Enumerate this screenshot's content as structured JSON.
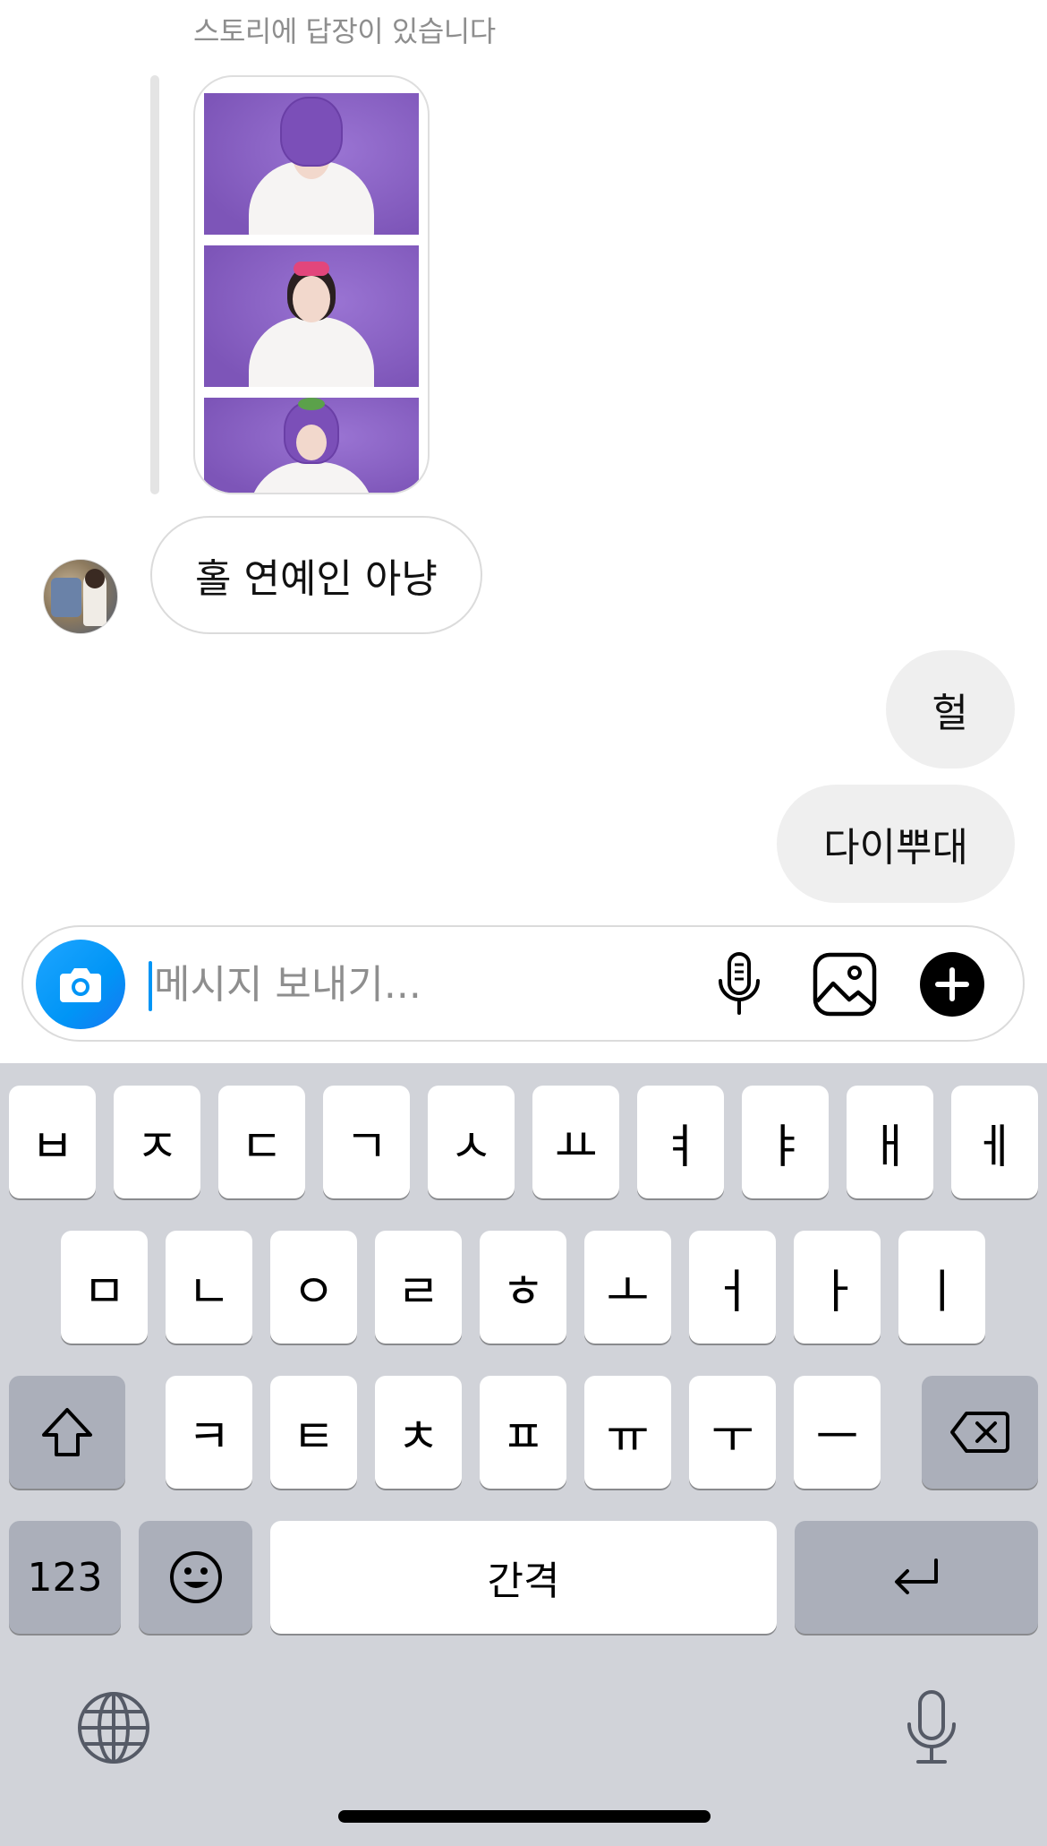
{
  "chat": {
    "story_reply_note": "스토리에 답장이 있습니다",
    "incoming": {
      "text": "홀 연예인 아냥"
    },
    "outgoing": [
      {
        "text": "헐"
      },
      {
        "text": "다이뿌대"
      }
    ]
  },
  "composer": {
    "placeholder": "메시지 보내기...",
    "value": "",
    "icons": [
      "camera-icon",
      "microphone-icon",
      "gallery-icon",
      "plus-icon"
    ]
  },
  "keyboard": {
    "row1": [
      "ㅂ",
      "ㅈ",
      "ㄷ",
      "ㄱ",
      "ㅅ",
      "ㅛ",
      "ㅕ",
      "ㅑ",
      "ㅐ",
      "ㅔ"
    ],
    "row2": [
      "ㅁ",
      "ㄴ",
      "ㅇ",
      "ㄹ",
      "ㅎ",
      "ㅗ",
      "ㅓ",
      "ㅏ",
      "ㅣ"
    ],
    "row3": [
      "ㅋ",
      "ㅌ",
      "ㅊ",
      "ㅍ",
      "ㅠ",
      "ㅜ",
      "ㅡ"
    ],
    "numbers_label": "123",
    "space_label": "간격",
    "icons": [
      "shift-icon",
      "backspace-icon",
      "emoji-icon",
      "return-icon",
      "globe-icon",
      "dictation-icon"
    ]
  },
  "colors": {
    "accent": "#0095f6",
    "keyboard_bg": "#d1d3d9",
    "key_dark": "#abafba",
    "bubble_out": "#efefef"
  }
}
